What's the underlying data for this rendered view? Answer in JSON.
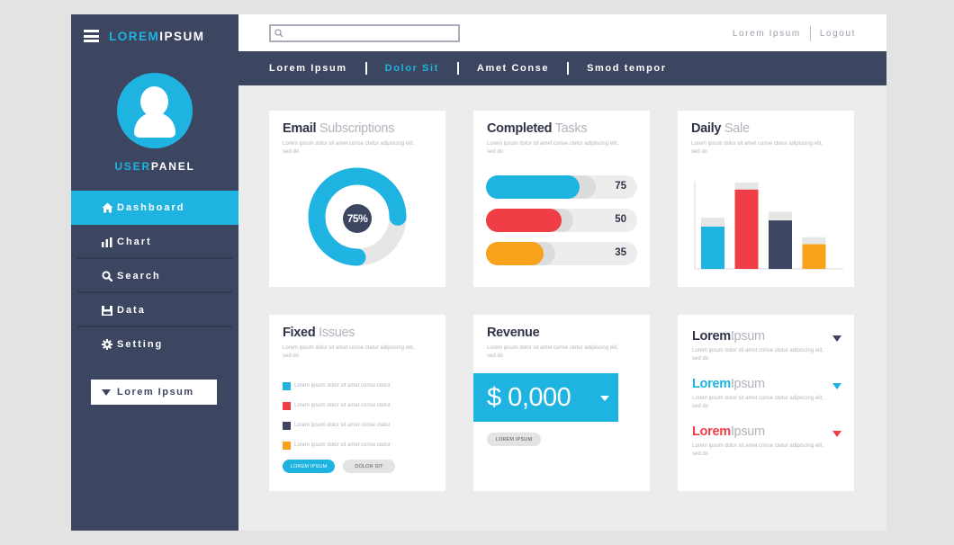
{
  "colors": {
    "accent": "#1eb3e0",
    "red": "#f03e47",
    "orange": "#f7a21b",
    "navy": "#3d4660"
  },
  "brand": {
    "part1": "LOREM",
    "part2": "IPSUM"
  },
  "user": {
    "part1": "USER",
    "part2": "PANEL"
  },
  "nav": [
    {
      "label": "Dashboard",
      "icon": "home-icon",
      "active": true
    },
    {
      "label": "Chart",
      "icon": "bar-chart-icon"
    },
    {
      "label": "Search",
      "icon": "search-icon"
    },
    {
      "label": "Data",
      "icon": "data-icon"
    },
    {
      "label": "Setting",
      "icon": "gear-icon"
    }
  ],
  "sidebar_dropdown": {
    "label": "Lorem Ipsum"
  },
  "search": {
    "placeholder": ""
  },
  "top_links": {
    "first": "Lorem Ipsum",
    "second": "Logout"
  },
  "menu": [
    {
      "label": "Lorem Ipsum"
    },
    {
      "label": "Dolor Sit",
      "active": true
    },
    {
      "label": "Amet Conse"
    },
    {
      "label": "Smod tempor"
    }
  ],
  "filler_text": "Lorem ipsum dolor sit amet conse ctetur adipiscing elit, sed do",
  "email_card": {
    "title_bold": "Email",
    "title_light": "Subscriptions",
    "percent_label": "75%",
    "percent": 75
  },
  "tasks_card": {
    "title_bold": "Completed",
    "title_light": "Tasks",
    "bars": [
      {
        "value": "75",
        "fill": 0.62,
        "color": "#1eb3e0"
      },
      {
        "value": "50",
        "fill": 0.5,
        "color": "#f03e47"
      },
      {
        "value": "35",
        "fill": 0.38,
        "color": "#f7a21b"
      }
    ]
  },
  "sale_card": {
    "title_bold": "Daily",
    "title_light": "Sale"
  },
  "chart_data": {
    "type": "bar",
    "categories": [
      "",
      "",
      "",
      ""
    ],
    "values": [
      48,
      90,
      55,
      28
    ],
    "background_values": [
      58,
      98,
      65,
      36
    ],
    "colors": [
      "#1eb3e0",
      "#f03e47",
      "#3d4660",
      "#f7a21b"
    ],
    "ylim": [
      0,
      100
    ],
    "grid": false
  },
  "issues_card": {
    "title_bold": "Fixed",
    "title_light": "Issues",
    "items": [
      {
        "text": "Lorem ipsum dolor sit amet conse ctetur",
        "color": "#1eb3e0"
      },
      {
        "text": "Lorem ipsum dolor sit amet conse ctetur",
        "color": "#f03e47"
      },
      {
        "text": "Lorem ipsum dolor sit amet conse ctetur",
        "color": "#3d4660"
      },
      {
        "text": "Lorem ipsum dolor sit amet conse ctetur",
        "color": "#f7a21b"
      }
    ],
    "button_primary": "LOREM IPSUM",
    "button_secondary": "DOLOR SIT"
  },
  "revenue_card": {
    "title": "Revenue",
    "value": "$ 0,000",
    "button": "LOREM IPSUM"
  },
  "lorem_card": {
    "rows": [
      {
        "bold": "Lorem",
        "light": "Ipsum",
        "color": "#2f3447",
        "arrow": "#3d4660"
      },
      {
        "bold": "Lorem",
        "light": "Ipsum",
        "color": "#1eb3e0",
        "arrow": "#1eb3e0"
      },
      {
        "bold": "Lorem",
        "light": "Ipsum",
        "color": "#f03e47",
        "arrow": "#f03e47"
      }
    ]
  }
}
